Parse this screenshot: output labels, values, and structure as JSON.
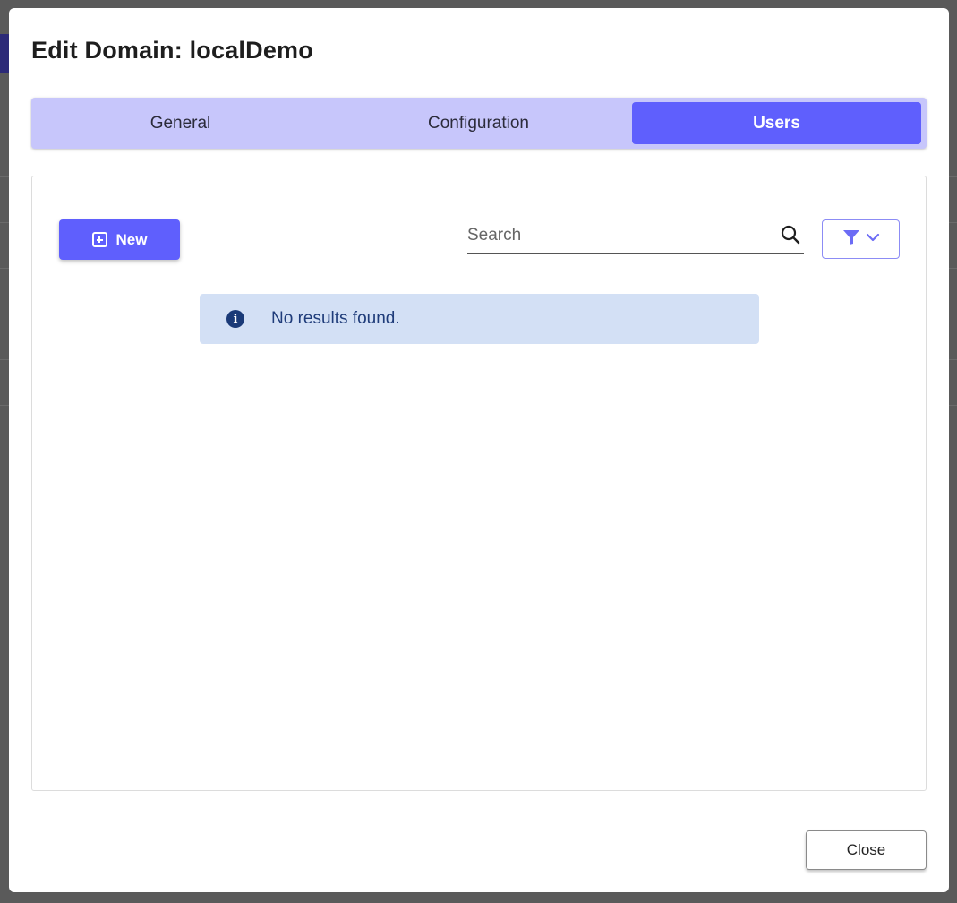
{
  "modal": {
    "title": "Edit Domain: localDemo"
  },
  "tabs": [
    {
      "label": "General",
      "active": false
    },
    {
      "label": "Configuration",
      "active": false
    },
    {
      "label": "Users",
      "active": true
    }
  ],
  "toolbar": {
    "new_label": "New",
    "search_placeholder": "Search",
    "search_value": ""
  },
  "alert": {
    "text": "No results found."
  },
  "footer": {
    "close_label": "Close"
  },
  "colors": {
    "accent": "#5f5ffd",
    "tabbar_bg": "#c7c6fb",
    "alert_bg": "#d3e0f5",
    "alert_text": "#1f3c7a"
  },
  "icons": {
    "new_button": "plus-square-icon",
    "search": "search-icon",
    "filter": "filter-icon",
    "filter_dropdown": "chevron-down-icon",
    "alert": "info-icon"
  }
}
